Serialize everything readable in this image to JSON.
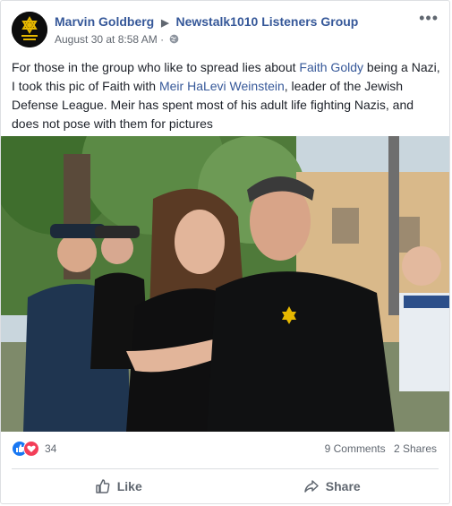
{
  "post": {
    "author": "Marvin Goldberg",
    "group": "Newstalk1010 Listeners Group",
    "timestamp": "August 30 at 8:58 AM",
    "privacy_icon": "globe-icon",
    "text_parts": [
      "For those in the group who like to spread lies about ",
      "Faith Goldy",
      " being a Nazi, I took this pic of Faith with ",
      "Meir HaLevi Weinstein",
      ", leader of the Jewish Defense League. Meir has spent most of his adult life fighting Nazis, and does not pose with them for pictures"
    ],
    "link_color": "#365899"
  },
  "reactions": {
    "count": "34",
    "icons": [
      "like-icon",
      "love-icon"
    ],
    "comments": "9 Comments",
    "shares": "2 Shares"
  },
  "actions": {
    "like_label": "Like",
    "share_label": "Share"
  },
  "colors": {
    "accent": "#365899",
    "like_blue": "#1877f2",
    "love_red": "#f33e58"
  }
}
